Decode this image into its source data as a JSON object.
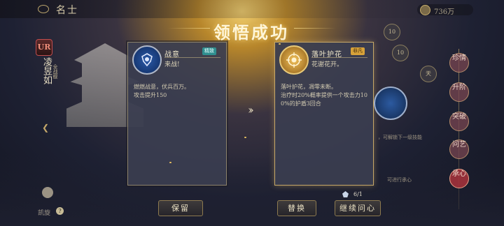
{
  "header": {
    "title": "名士",
    "currency_value": "736万"
  },
  "headline": "领悟成功",
  "character": {
    "rarity": "UR",
    "name": "凌昱如",
    "tag": "全战舰"
  },
  "cards": {
    "left": {
      "skill_name": "战意",
      "badge": "精致",
      "short": "来战!",
      "desc": "燃燃战意，伏兵百万。\n攻击提升150"
    },
    "right": {
      "skill_name": "落叶护花",
      "badge": "非凡",
      "short": "花谢花开。",
      "desc": "落叶护花，凋零未断。\n治疗时20%概率提供一个攻击力10\n0%的护盾3回合"
    }
  },
  "side_panel": {
    "nodes": [
      "10",
      "10",
      "天"
    ],
    "text_1": "，可解锁下一级技能",
    "text_2": "可进行承心",
    "tabs": [
      "珍情",
      "升阶",
      "突破",
      "问艺",
      "承心"
    ]
  },
  "bottom_left": {
    "label": "凯旋"
  },
  "counter": "6/1",
  "buttons": {
    "keep": "保留",
    "replace": "替换",
    "continue": "继续问心"
  },
  "colors": {
    "accent_gold": "#c7a867",
    "badge_jing": "#2f8f8f",
    "badge_fei": "#d7a23a",
    "active_tab": "#aa323c"
  }
}
